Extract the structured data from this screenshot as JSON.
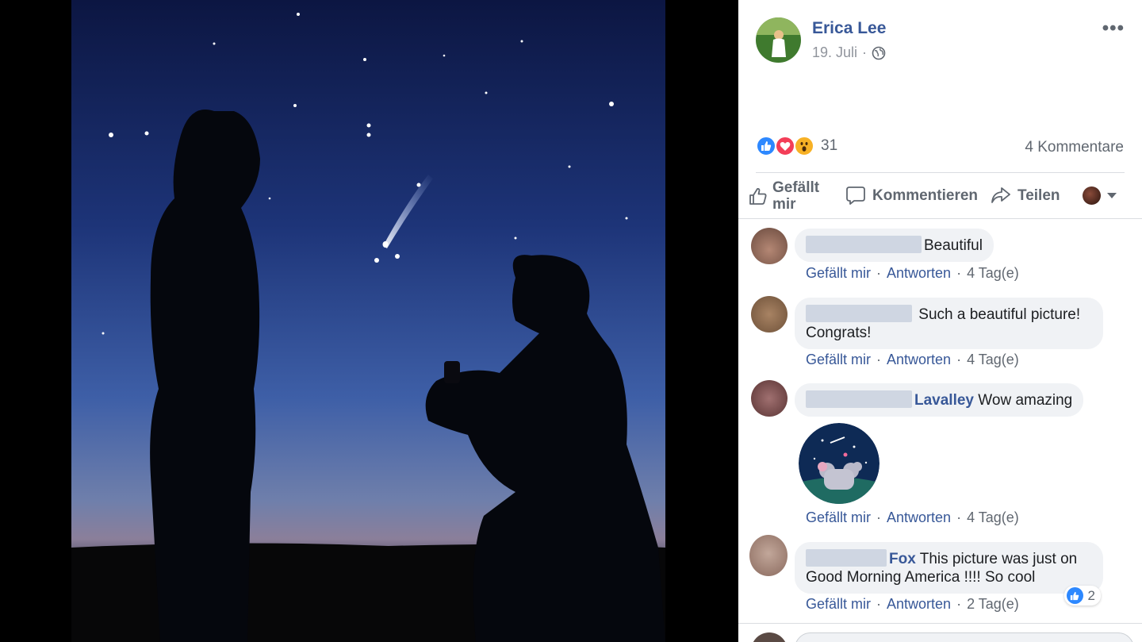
{
  "post": {
    "author": "Erica Lee",
    "date": "19. Juli",
    "date_sep": "·",
    "more_label": "•••",
    "reaction_count": "31",
    "reactions": [
      "like-icon",
      "love-icon",
      "wow-icon"
    ],
    "comment_count_label": "4 Kommentare"
  },
  "actions": {
    "like": "Gefällt mir",
    "comment": "Kommentieren",
    "share": "Teilen"
  },
  "comments": [
    {
      "name": "",
      "text": "Beautiful",
      "like": "Gefällt mir",
      "reply": "Antworten",
      "time": "4 Tag(e)"
    },
    {
      "name": "",
      "text": "Such a beautiful picture! Congrats!",
      "like": "Gefällt mir",
      "reply": "Antworten",
      "time": "4 Tag(e)"
    },
    {
      "name": "Lavalley",
      "text": "Wow amazing",
      "like": "Gefällt mir",
      "reply": "Antworten",
      "time": "4 Tag(e)"
    },
    {
      "name": "Fox",
      "text": "This picture was just on Good Morning America !!!! So cool",
      "like": "Gefällt mir",
      "reply": "Antworten",
      "time": "2 Tag(e)",
      "likes": "2"
    }
  ],
  "colors": {
    "link": "#385898",
    "like_blue": "#2d88ff",
    "love_red": "#f33e58",
    "wow_yellow": "#f7b125",
    "bubble": "#f0f2f5"
  }
}
